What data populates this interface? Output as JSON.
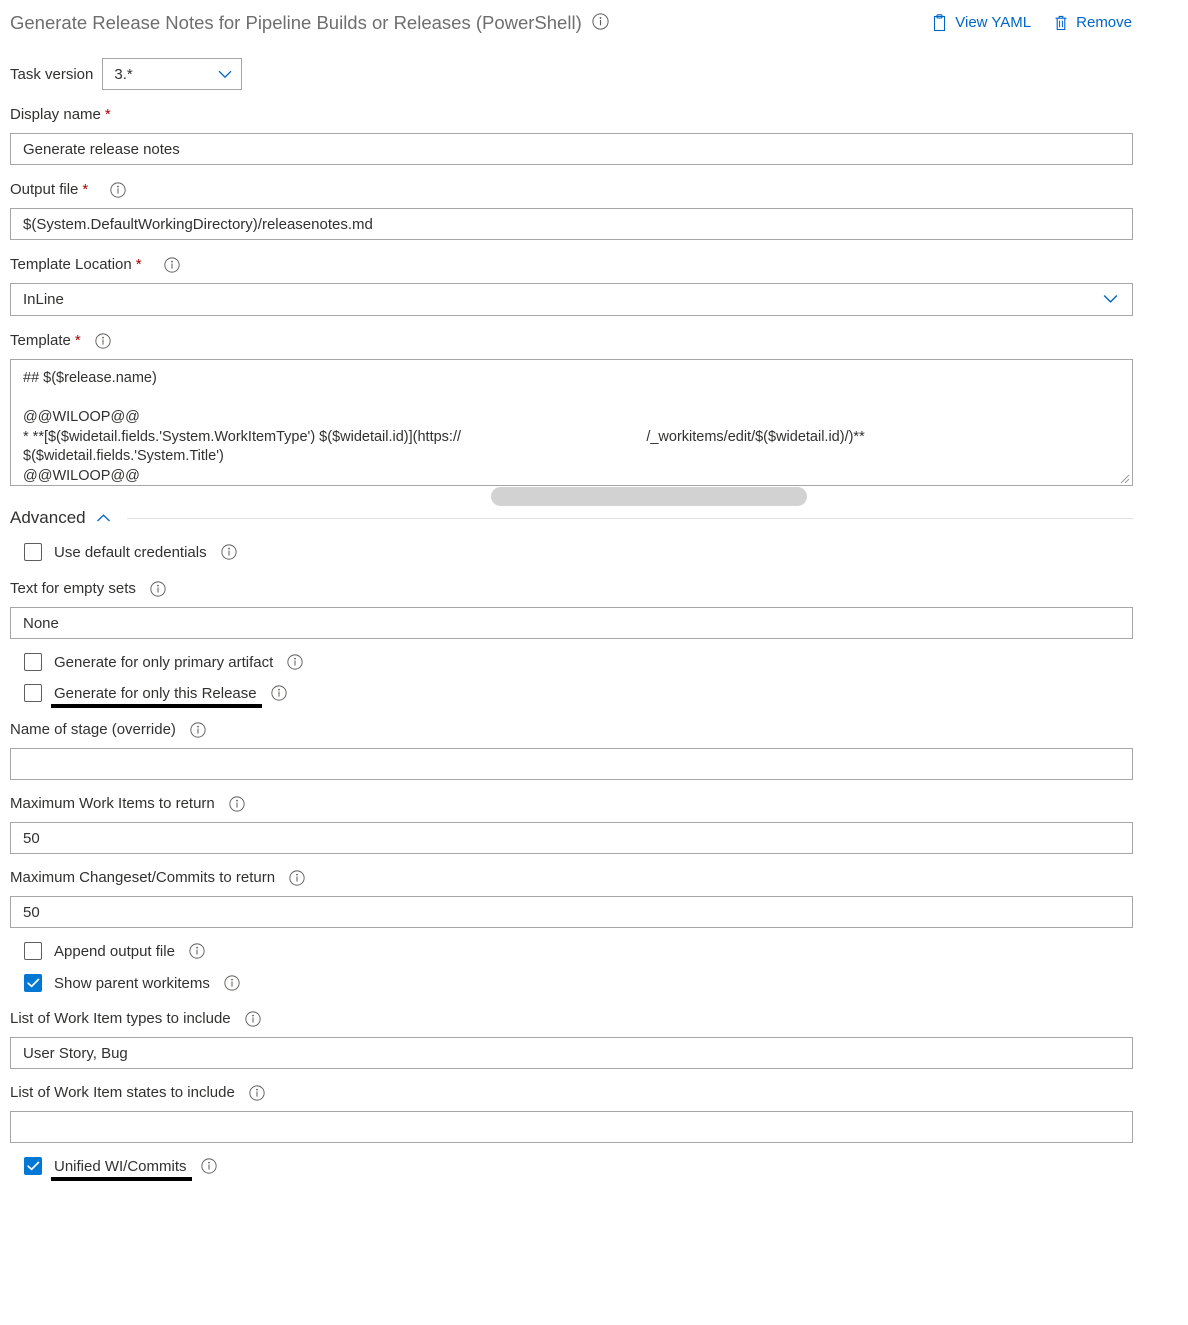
{
  "header": {
    "title": "Generate Release Notes for Pipeline Builds or Releases (PowerShell)",
    "title_info_icon": "info-icon",
    "actions": [
      {
        "label": "View YAML",
        "icon": "clipboard-icon"
      },
      {
        "label": "Remove",
        "icon": "trash-icon"
      }
    ]
  },
  "task_version": {
    "label": "Task version",
    "value": "3.*",
    "chevron_icon": "chevron-down-icon"
  },
  "fields": {
    "display_name": {
      "label": "Display name",
      "required": "*",
      "value": "Generate release notes"
    },
    "output_file": {
      "label": "Output file",
      "required": "*",
      "info_icon": "info-icon",
      "value": "$(System.DefaultWorkingDirectory)/releasenotes.md"
    },
    "template_location": {
      "label": "Template Location",
      "required": "*",
      "info_icon": "info-icon",
      "value": "InLine",
      "chevron_icon": "chevron-down-icon"
    },
    "template": {
      "label": "Template",
      "required": "*",
      "info_icon": "info-icon",
      "value_line1": "## $($release.name)",
      "value_line2": "",
      "value_line3": "@@WILOOP@@",
      "value_line4": "* **[$($widetail.fields.'System.WorkItemType') $($widetail.id)](https://                                              /_workitems/edit/$($widetail.id)/)**",
      "value_line5": "$($widetail.fields.'System.Title')",
      "value_line6": "@@WILOOP@@",
      "redacted_region": "redacted-url-host"
    },
    "text_empty_sets": {
      "label": "Text for empty sets",
      "info_icon": "info-icon",
      "value": "None"
    },
    "stage_name_override": {
      "label": "Name of stage (override)",
      "info_icon": "info-icon",
      "value": ""
    },
    "max_work_items": {
      "label": "Maximum Work Items to return",
      "info_icon": "info-icon",
      "value": "50"
    },
    "max_changesets": {
      "label": "Maximum Changeset/Commits to return",
      "info_icon": "info-icon",
      "value": "50"
    },
    "wi_types": {
      "label": "List of Work Item types to include",
      "info_icon": "info-icon",
      "value": "User Story, Bug"
    },
    "wi_states": {
      "label": "List of Work Item states to include",
      "info_icon": "info-icon",
      "value": ""
    }
  },
  "advanced": {
    "label": "Advanced",
    "chevron_icon": "chevron-up-icon"
  },
  "checkboxes": {
    "use_default_credentials": {
      "label": "Use default credentials",
      "checked": false,
      "highlighted": false
    },
    "only_primary_artifact": {
      "label": "Generate for only primary artifact",
      "checked": false,
      "highlighted": false
    },
    "only_this_release": {
      "label": "Generate for only this Release",
      "checked": false,
      "highlighted": true
    },
    "append_output_file": {
      "label": "Append output file",
      "checked": false,
      "highlighted": false
    },
    "show_parent_workitems": {
      "label": "Show parent workitems",
      "checked": true,
      "highlighted": false
    },
    "unified_wi_commits": {
      "label": "Unified WI/Commits",
      "checked": true,
      "highlighted": true
    }
  },
  "colors": {
    "link": "#0064c8",
    "accent": "#0078d4",
    "required": "#a80000",
    "border": "#a6a6a6",
    "redaction": "#d2d2d2",
    "title": "#6e6e6e"
  }
}
